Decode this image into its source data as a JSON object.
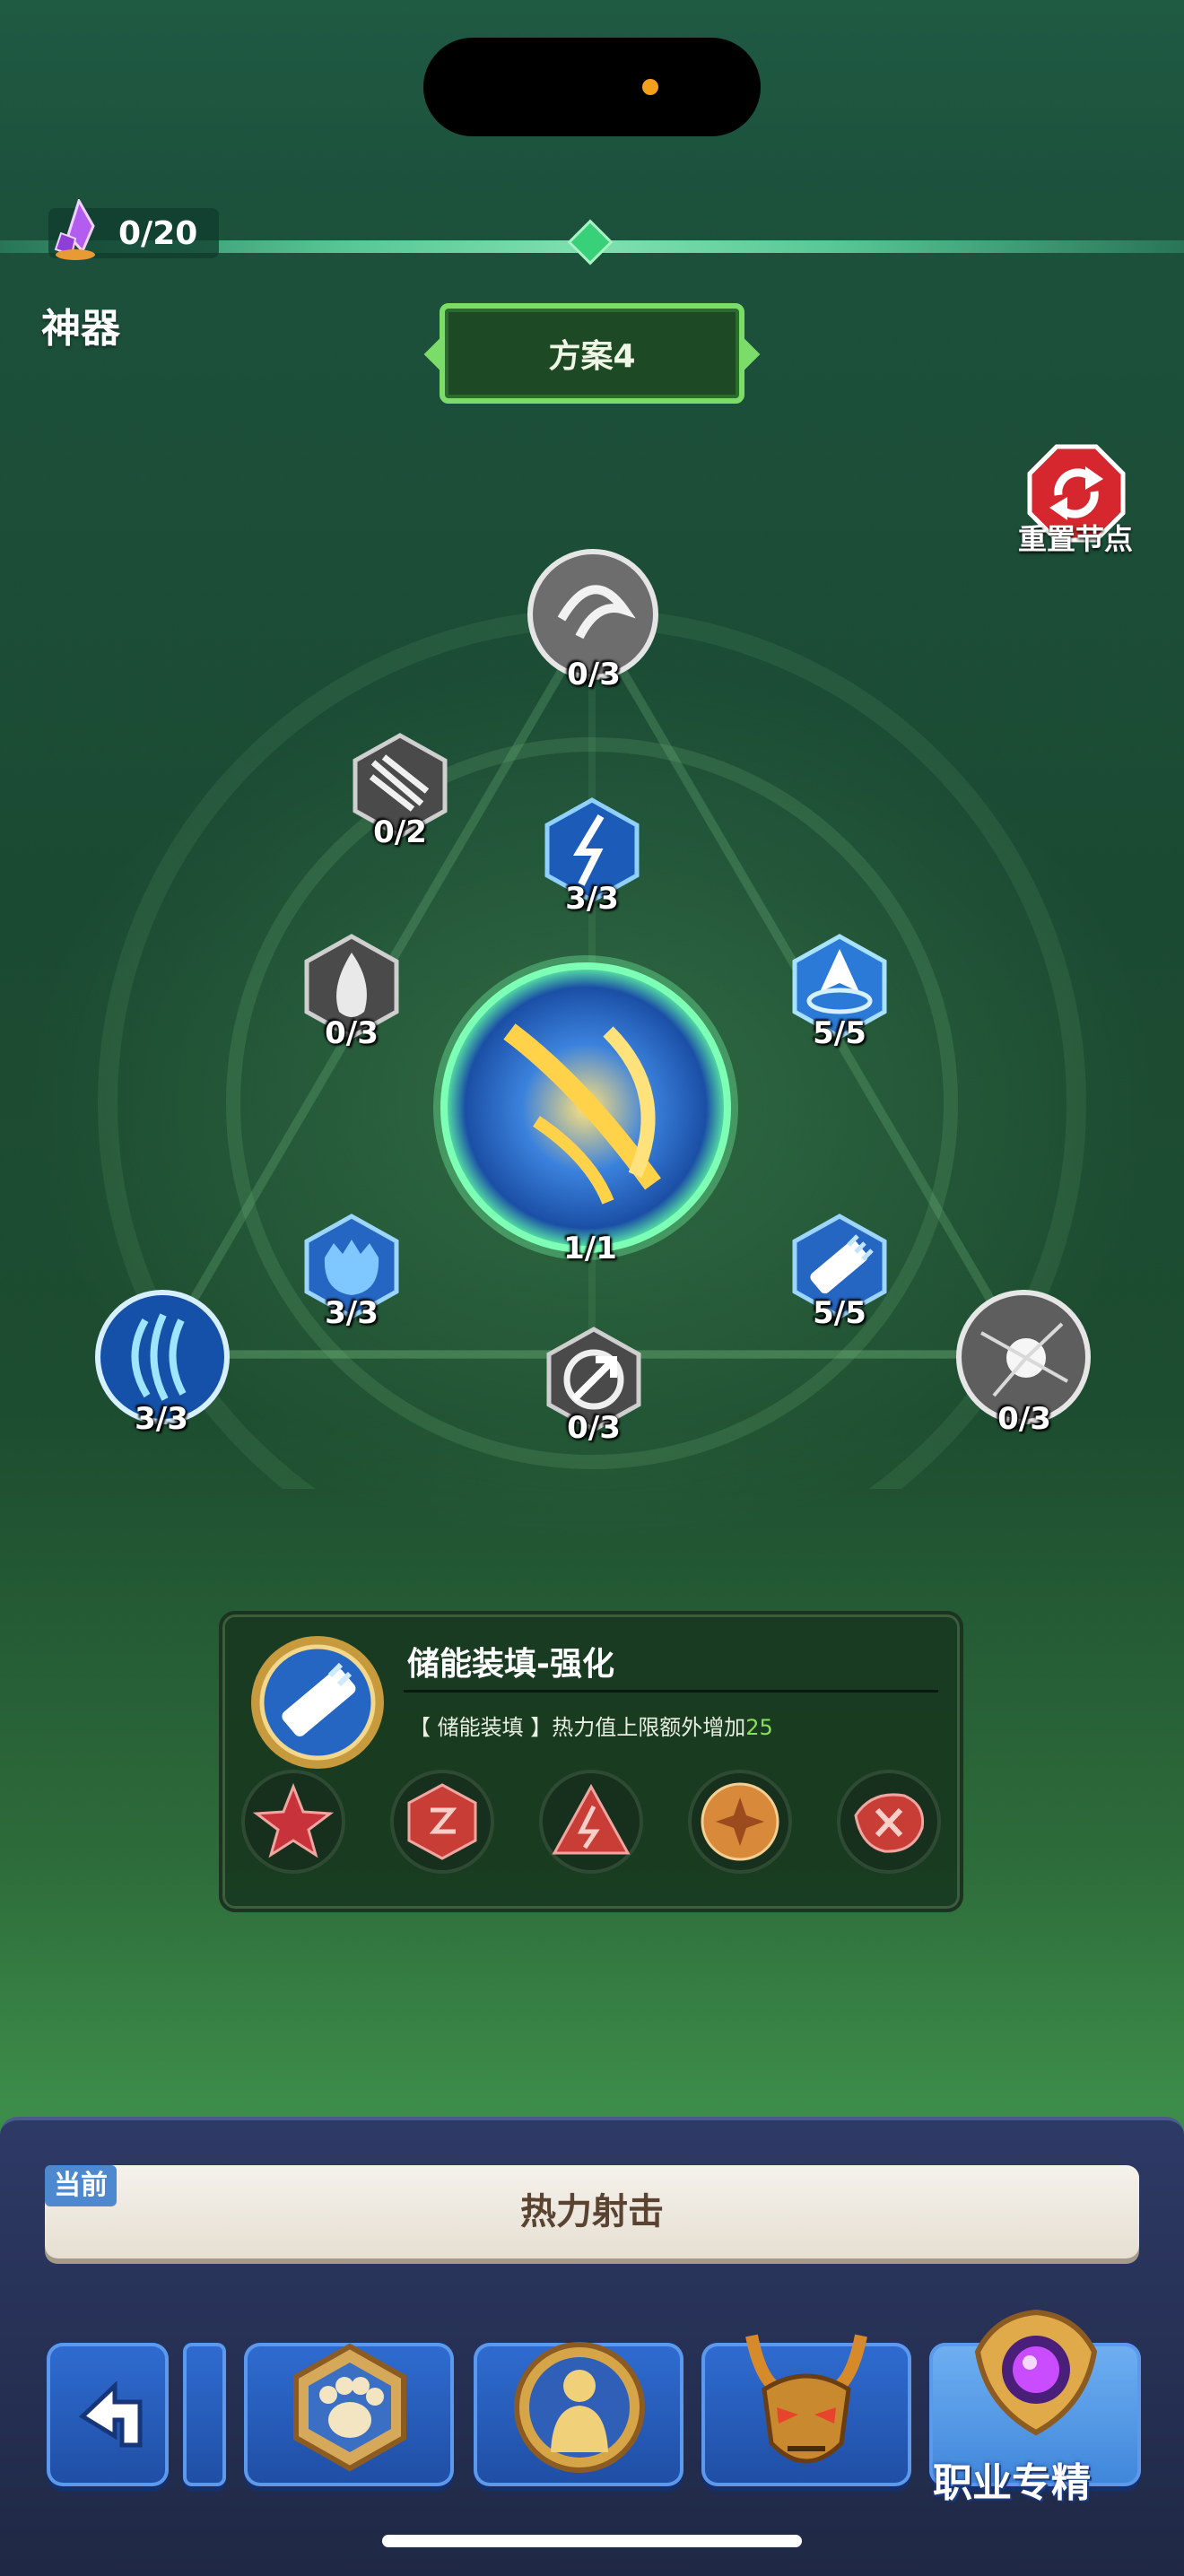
{
  "header": {
    "crystal_count": "0/20",
    "section_title": "神器",
    "plan_label": "方案4",
    "reset_label": "重置节点"
  },
  "tree": {
    "center": {
      "count": "1/1",
      "icon": "golden-shock-orb-icon"
    },
    "nodes": [
      {
        "id": "top",
        "count": "0/3",
        "icon": "wind-swirl-icon",
        "state": "locked"
      },
      {
        "id": "upper-left",
        "count": "0/2",
        "icon": "claw-slash-icon",
        "state": "locked"
      },
      {
        "id": "upper-center",
        "count": "3/3",
        "icon": "lightning-arrow-icon",
        "state": "active"
      },
      {
        "id": "mid-left",
        "count": "0/3",
        "icon": "flame-icon",
        "state": "locked"
      },
      {
        "id": "mid-right",
        "count": "5/5",
        "icon": "blue-arrowhead-icon",
        "state": "active"
      },
      {
        "id": "lower-left",
        "count": "3/3",
        "icon": "spiky-shield-icon",
        "state": "active"
      },
      {
        "id": "lower-right",
        "count": "5/5",
        "icon": "charged-ammo-icon",
        "state": "active"
      },
      {
        "id": "bottom",
        "count": "0/3",
        "icon": "crossed-arrows-icon",
        "state": "locked"
      },
      {
        "id": "far-left",
        "count": "3/3",
        "icon": "blue-vortex-icon",
        "state": "active"
      },
      {
        "id": "far-right",
        "count": "0/3",
        "icon": "shatter-icon",
        "state": "locked"
      }
    ]
  },
  "skill": {
    "title": "储能装填-强化",
    "desc_prefix": "【 储能装填 】热力值上限额外增加",
    "desc_value": "25",
    "icon": "charged-ammo-icon"
  },
  "runes": [
    "red-star-rune-icon",
    "red-hexagon-rune-icon",
    "red-triangle-rune-icon",
    "orange-circle-rune-icon",
    "red-scroll-rune-icon"
  ],
  "current": {
    "tag": "当前",
    "name": "热力射击"
  },
  "bottom_bar": {
    "buttons": [
      "back-arrow-icon",
      "pet-paw-icon",
      "hero-statue-icon",
      "demon-mask-icon",
      "purple-orb-icon"
    ],
    "spec_label": "职业专精"
  },
  "colors": {
    "accent_green": "#7bdc6a",
    "highlight_value": "#89e05a",
    "button_blue": "#2f6cd1",
    "panel_navy": "#2e3a66"
  }
}
